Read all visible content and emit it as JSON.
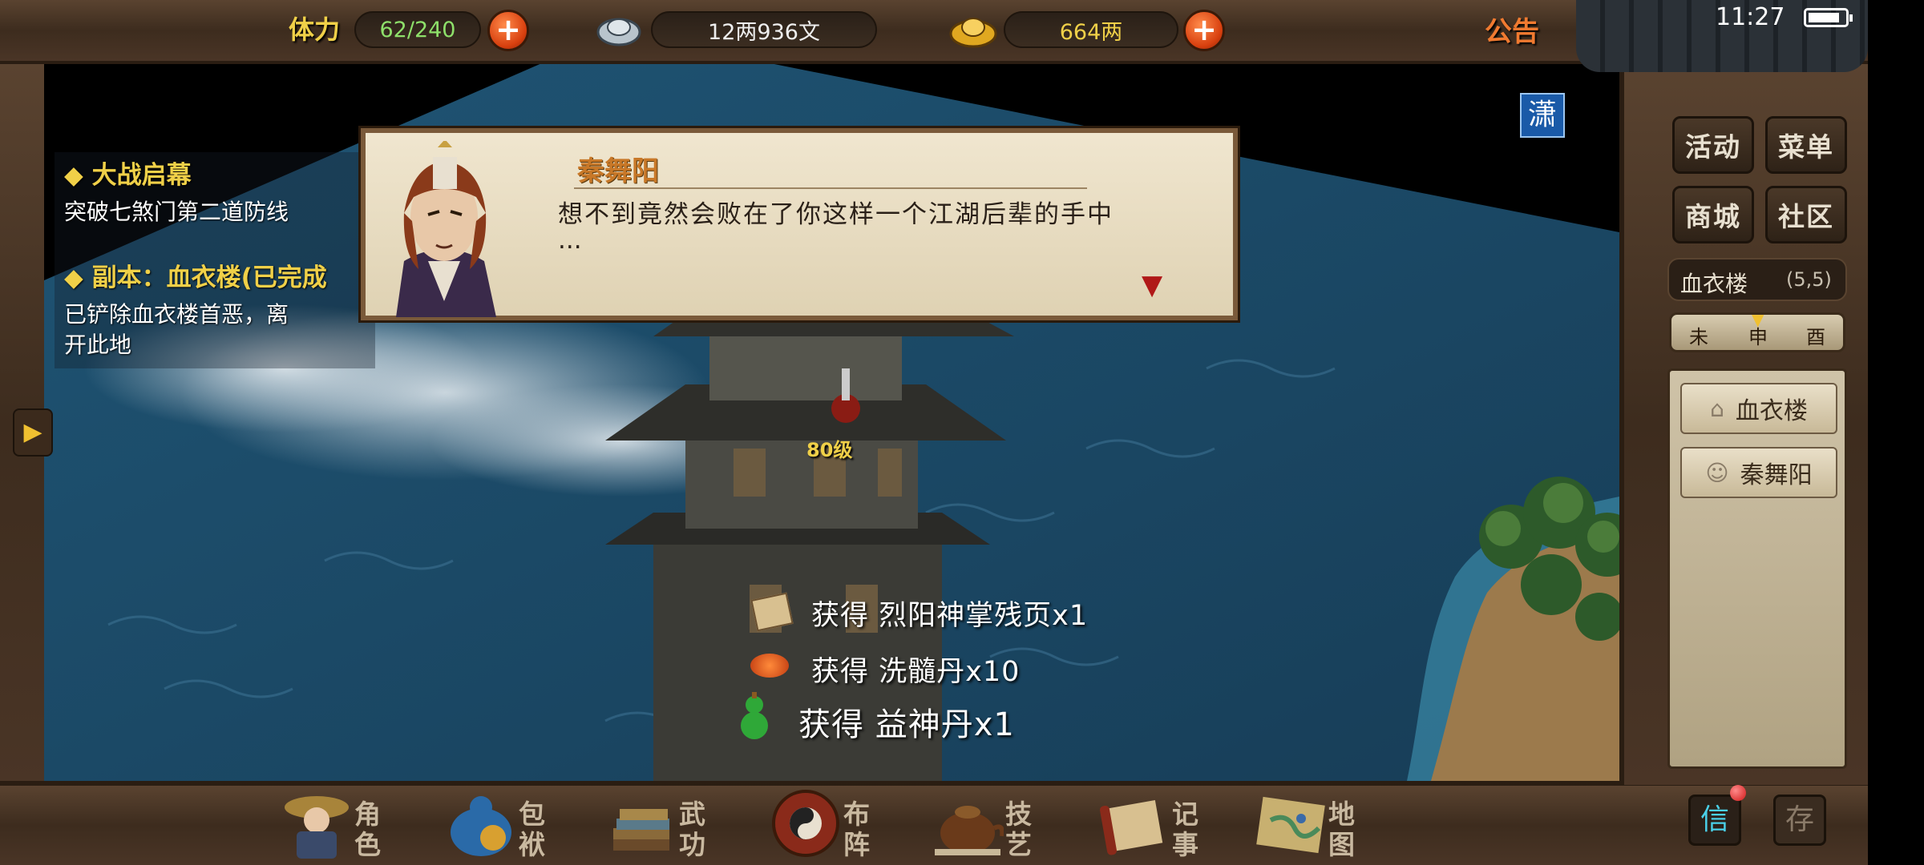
{
  "top": {
    "stamina_label": "体力",
    "stamina_value": "62/240",
    "silver_value": "12两936文",
    "gold_value": "664两",
    "notice": "公告"
  },
  "status": {
    "time": "11:27"
  },
  "mini_tag": "潇",
  "quest": {
    "title1": "大战启幕",
    "desc1": "突破七煞门第二道防线",
    "title2": "副本：血衣楼(已完成",
    "desc2": "已铲除血衣楼首恶，离开此地"
  },
  "dialog": {
    "speaker": "秦舞阳",
    "text": "想不到竟然会败在了你这样一个江湖后辈的手中",
    "ellipsis": "..."
  },
  "npc_level": "80级",
  "rewards": [
    {
      "text": "获得 烈阳神掌残页x1"
    },
    {
      "text": "获得 洗髓丹x10"
    },
    {
      "text": "获得 益神丹x1"
    }
  ],
  "right_menu": {
    "activity": "活动",
    "menu": "菜单",
    "shop": "商城",
    "community": "社区",
    "location": "血衣楼",
    "coords": "(5,5)",
    "time_marks": [
      "未",
      "申",
      "酉"
    ],
    "cards": [
      {
        "label": "血衣楼",
        "icon": "house-icon"
      },
      {
        "label": "秦舞阳",
        "icon": "person-icon"
      }
    ],
    "mail": "信",
    "save": "存"
  },
  "bottom_nav": [
    {
      "label": "角色",
      "icon": "character-icon"
    },
    {
      "label": "包袱",
      "icon": "bag-icon"
    },
    {
      "label": "武功",
      "icon": "martial-arts-icon"
    },
    {
      "label": "布阵",
      "icon": "formation-icon"
    },
    {
      "label": "技艺",
      "icon": "teapot-icon"
    },
    {
      "label": "记事",
      "icon": "scroll-icon"
    },
    {
      "label": "地图",
      "icon": "map-icon"
    }
  ],
  "colors": {
    "gold": "#f0d048",
    "accent_red": "#e0501a",
    "water": "#1d4a66",
    "wood": "#4a3526"
  }
}
